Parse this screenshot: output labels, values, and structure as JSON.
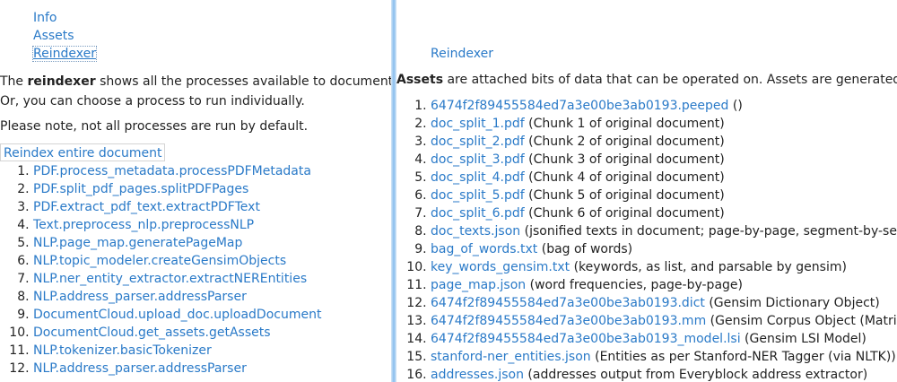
{
  "tabs": [
    {
      "label": "Info"
    },
    {
      "label": "Assets"
    },
    {
      "label": "Reindexer"
    }
  ],
  "left": {
    "intro_pre": "The ",
    "intro_bold": "reindexer",
    "intro_post": " shows all the processes available to documents of this",
    "intro_line2": "Or, you can choose a process to run individually.",
    "note": "Please note, not all processes are run by default.",
    "reindex_button": "Reindex entire document",
    "processes": [
      "PDF.process_metadata.processPDFMetadata",
      "PDF.split_pdf_pages.splitPDFPages",
      "PDF.extract_pdf_text.extractPDFText",
      "Text.preprocess_nlp.preprocessNLP",
      "NLP.page_map.generatePageMap",
      "NLP.topic_modeler.createGensimObjects",
      "NLP.ner_entity_extractor.extractNEREntities",
      "NLP.address_parser.addressParser",
      "DocumentCloud.upload_doc.uploadDocument",
      "DocumentCloud.get_assets.getAssets",
      "NLP.tokenizer.basicTokenizer",
      "NLP.address_parser.addressParser"
    ]
  },
  "right": {
    "crumb": "Reindexer",
    "intro_bold": "Assets",
    "intro_post": " are attached bits of data that can be operated on. Assets are generated during th",
    "assets": [
      {
        "file": "6474f2f89455584ed7a3e00be3ab0193.peeped",
        "desc": " ()"
      },
      {
        "file": "doc_split_1.pdf",
        "desc": " (Chunk 1 of original document)"
      },
      {
        "file": "doc_split_2.pdf",
        "desc": " (Chunk 2 of original document)"
      },
      {
        "file": "doc_split_3.pdf",
        "desc": " (Chunk 3 of original document)"
      },
      {
        "file": "doc_split_4.pdf",
        "desc": " (Chunk 4 of original document)"
      },
      {
        "file": "doc_split_5.pdf",
        "desc": " (Chunk 5 of original document)"
      },
      {
        "file": "doc_split_6.pdf",
        "desc": " (Chunk 6 of original document)"
      },
      {
        "file": "doc_texts.json",
        "desc": " (jsonified texts in document; page-by-page, segment-by-segment. u"
      },
      {
        "file": "bag_of_words.txt",
        "desc": " (bag of words)"
      },
      {
        "file": "key_words_gensim.txt",
        "desc": " (keywords, as list, and parsable by gensim)"
      },
      {
        "file": "page_map.json",
        "desc": " (word frequencies, page-by-page)"
      },
      {
        "file": "6474f2f89455584ed7a3e00be3ab0193.dict",
        "desc": " (Gensim Dictionary Object)"
      },
      {
        "file": "6474f2f89455584ed7a3e00be3ab0193.mm",
        "desc": " (Gensim Corpus Object (Matrix))"
      },
      {
        "file": "6474f2f89455584ed7a3e00be3ab0193_model.lsi",
        "desc": " (Gensim LSI Model)"
      },
      {
        "file": "stanford-ner_entities.json",
        "desc": " (Entities as per Stanford-NER Tagger (via NLTK))"
      },
      {
        "file": "addresses.json",
        "desc": " (addresses output from Everyblock address extractor)"
      }
    ]
  },
  "colors": {
    "link": "#2a7ac8",
    "text": "#222222",
    "divider": "#8fc1ee"
  }
}
